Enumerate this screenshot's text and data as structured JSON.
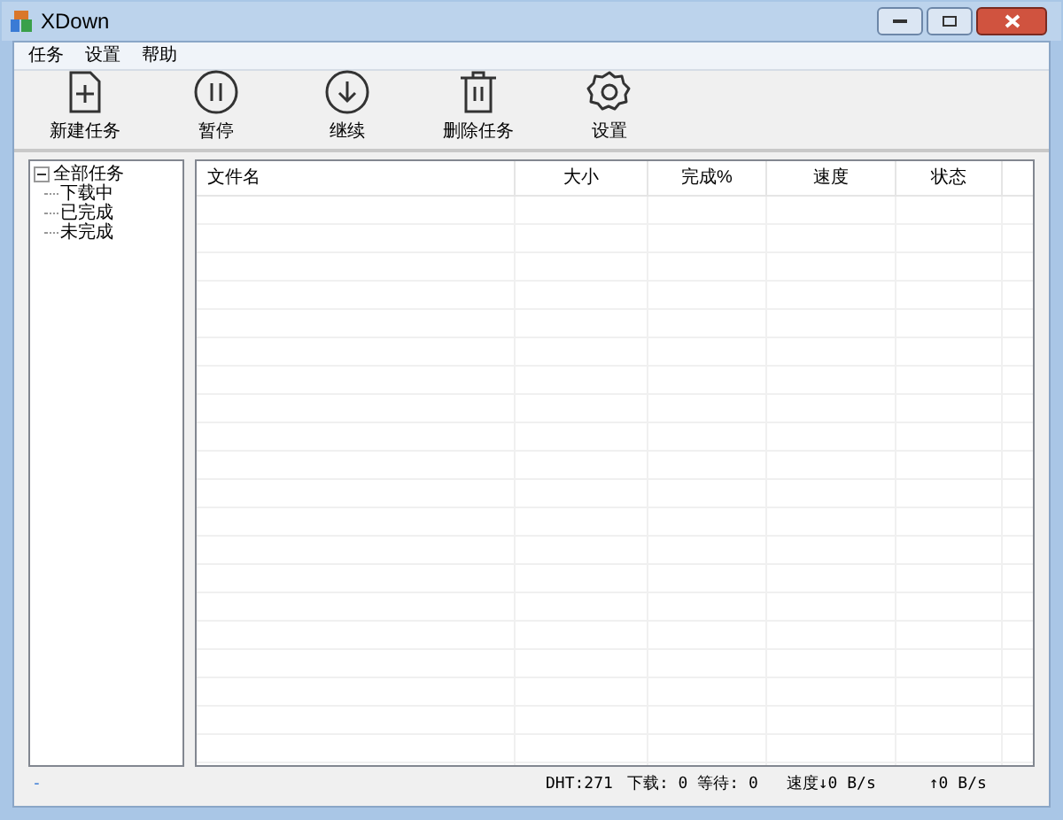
{
  "window": {
    "title": "XDown"
  },
  "menu": [
    "任务",
    "设置",
    "帮助"
  ],
  "toolbar": [
    {
      "kind": "new",
      "label": "新建任务"
    },
    {
      "kind": "pause",
      "label": "暂停"
    },
    {
      "kind": "resume",
      "label": "继续"
    },
    {
      "kind": "delete",
      "label": "删除任务"
    },
    {
      "kind": "settings",
      "label": "设置"
    }
  ],
  "tree": {
    "label": "全部任务",
    "expanded": true,
    "children": [
      {
        "label": "下载中"
      },
      {
        "label": "已完成"
      },
      {
        "label": "未完成"
      }
    ]
  },
  "table": {
    "columns": [
      "文件名",
      "大小",
      "完成%",
      "速度",
      "状态"
    ]
  },
  "status_bar": {
    "left": "-",
    "dht": "DHT:271",
    "queue": "下载: 0 等待: 0",
    "down": "速度↓0 B/s",
    "up": "↑0 B/s"
  }
}
